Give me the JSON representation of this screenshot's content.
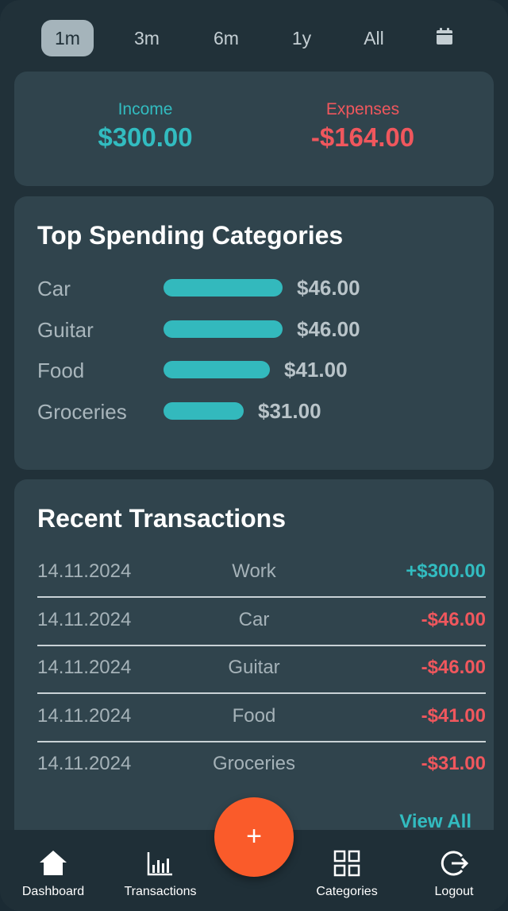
{
  "periods": [
    {
      "label": "1m",
      "active": true
    },
    {
      "label": "3m",
      "active": false
    },
    {
      "label": "6m",
      "active": false
    },
    {
      "label": "1y",
      "active": false
    },
    {
      "label": "All",
      "active": false
    }
  ],
  "calendar_icon": "calendar-icon",
  "summary": {
    "income_label": "Income",
    "income_value": "$300.00",
    "expenses_label": "Expenses",
    "expenses_value": "-$164.00"
  },
  "top_spending": {
    "title": "Top Spending Categories",
    "categories": [
      {
        "name": "Car",
        "amount": "$46.00",
        "value": 46
      },
      {
        "name": "Guitar",
        "amount": "$46.00",
        "value": 46
      },
      {
        "name": "Food",
        "amount": "$41.00",
        "value": 41
      },
      {
        "name": "Groceries",
        "amount": "$31.00",
        "value": 31
      }
    ]
  },
  "recent": {
    "title": "Recent Transactions",
    "transactions": [
      {
        "date": "14.11.2024",
        "category": "Work",
        "amount": "+$300.00",
        "type": "income"
      },
      {
        "date": "14.11.2024",
        "category": "Car",
        "amount": "-$46.00",
        "type": "expense"
      },
      {
        "date": "14.11.2024",
        "category": "Guitar",
        "amount": "-$46.00",
        "type": "expense"
      },
      {
        "date": "14.11.2024",
        "category": "Food",
        "amount": "-$41.00",
        "type": "expense"
      },
      {
        "date": "14.11.2024",
        "category": "Groceries",
        "amount": "-$31.00",
        "type": "expense"
      }
    ],
    "view_all_label": "View All"
  },
  "fab_label": "+",
  "nav": [
    {
      "label": "Dashboard",
      "icon": "home-icon"
    },
    {
      "label": "Transactions",
      "icon": "bar-chart-icon"
    },
    {
      "label": "Categories",
      "icon": "grid-icon"
    },
    {
      "label": "Logout",
      "icon": "logout-icon"
    }
  ],
  "colors": {
    "income": "#32bcc0",
    "expense": "#f0575d",
    "accent": "#fa5b2a",
    "bar": "#33b9bd"
  }
}
